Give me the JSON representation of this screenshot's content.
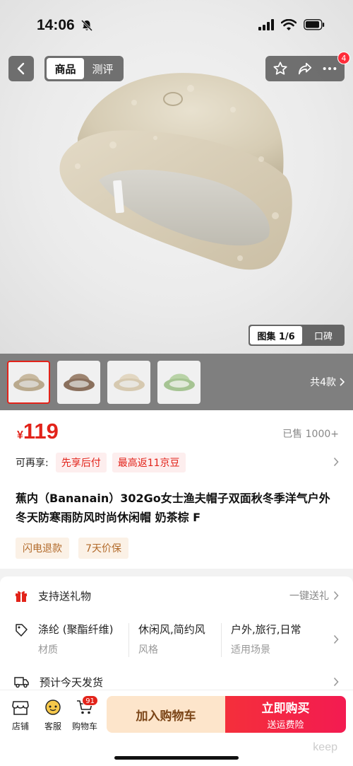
{
  "status_bar": {
    "time": "14:06"
  },
  "header": {
    "tabs": [
      {
        "label": "商品",
        "active": true
      },
      {
        "label": "测评",
        "active": false
      }
    ],
    "notification_count": "4"
  },
  "gallery": {
    "active_label": "图集 1/6",
    "other_label": "口碑",
    "variant_count_label": "共4款"
  },
  "thumbnails": [
    {
      "name": "hat-variant-milk-tea",
      "color": "#c8b9a0",
      "selected": true
    },
    {
      "name": "hat-variant-brown",
      "color": "#9d8470",
      "selected": false
    },
    {
      "name": "hat-variant-cream",
      "color": "#e2d7c2",
      "selected": false
    },
    {
      "name": "hat-variant-green",
      "color": "#b9d3a7",
      "selected": false
    }
  ],
  "product": {
    "currency": "¥",
    "price": "119",
    "sold": "已售 1000+",
    "perks_label": "可再享:",
    "perks": [
      "先享后付",
      "最高返11京豆"
    ],
    "title": "蕉内（Bananain）302Go女士渔夫帽子双面秋冬季洋气户外冬天防寒雨防风时尚休闲帽 奶茶棕 F",
    "service_tags": [
      "闪电退款",
      "7天价保"
    ]
  },
  "info": {
    "gift_label": "支持送礼物",
    "gift_action": "一键送礼",
    "attributes": [
      {
        "value": "涤纶 (聚酯纤维)",
        "key": "材质"
      },
      {
        "value": "休闲风,简约风",
        "key": "风格"
      },
      {
        "value": "户外,旅行,日常",
        "key": "适用场景"
      }
    ],
    "shipping": "预计今天发货"
  },
  "bottom_bar": {
    "store": "店铺",
    "service": "客服",
    "cart": "购物车",
    "cart_count": "91",
    "add_to_cart": "加入购物车",
    "buy_now": "立即购买",
    "buy_now_sub": "送运费险",
    "watermark": "keep"
  },
  "colors": {
    "accent_red": "#e2231a",
    "cart_button_bg": "#fde5cb",
    "buy_button_bg": "#f42f3b"
  }
}
